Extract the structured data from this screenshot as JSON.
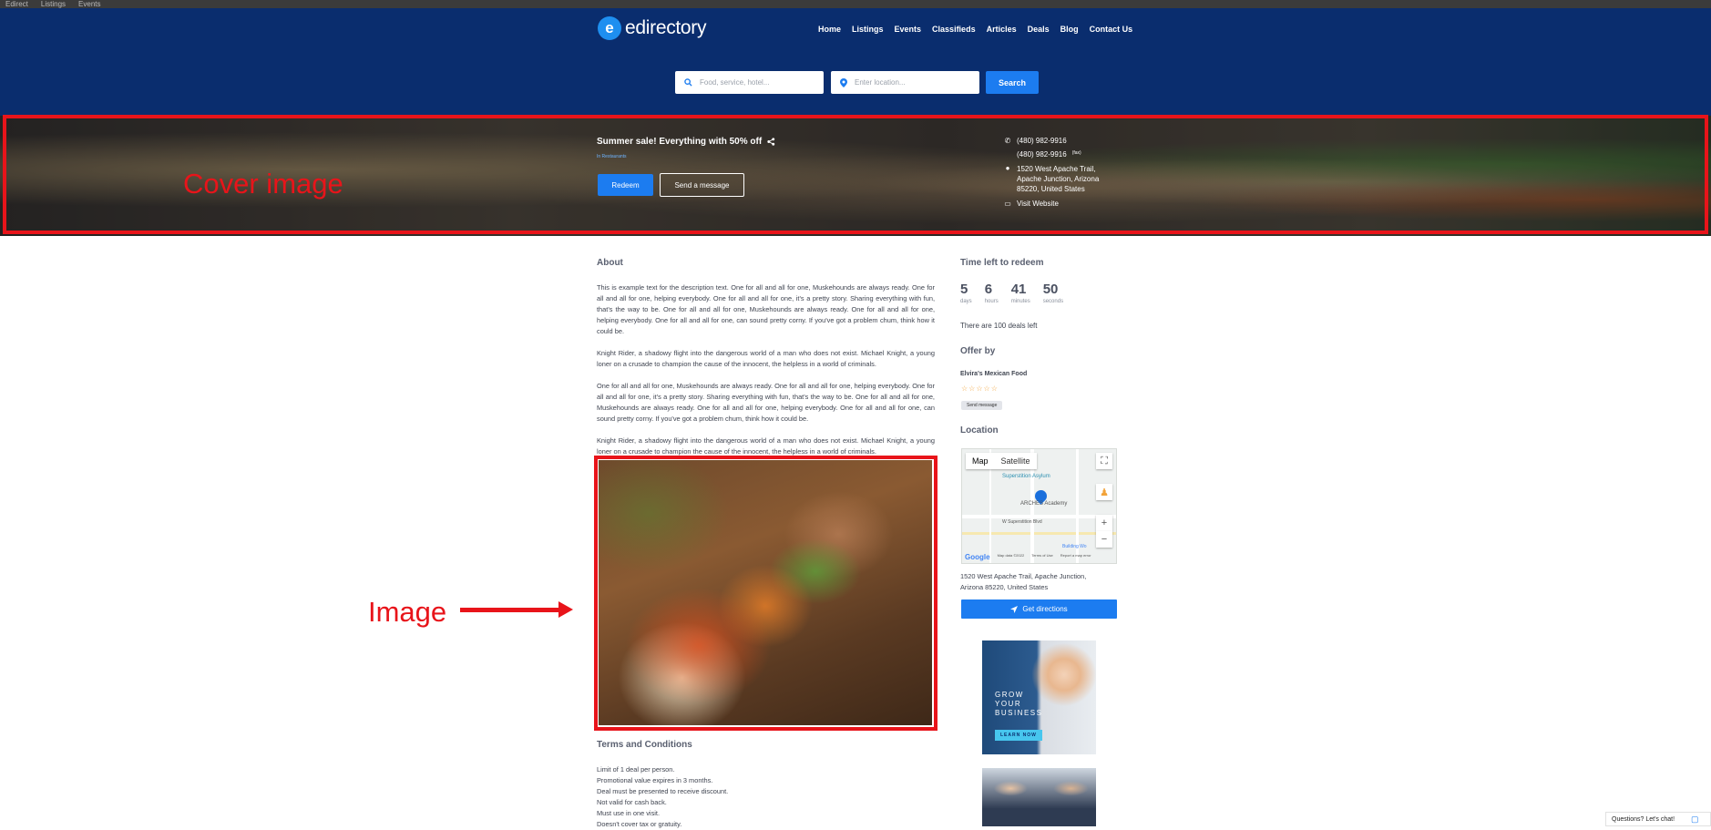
{
  "browser": {
    "tabs": [
      "Edirect",
      "Listings",
      "Events"
    ]
  },
  "brand": {
    "name": "edirectory",
    "badge": "e"
  },
  "nav": {
    "items": [
      "Home",
      "Listings",
      "Events",
      "Classifieds",
      "Articles",
      "Deals",
      "Blog",
      "Contact Us"
    ]
  },
  "search": {
    "keyword_placeholder": "Food, service, hotel...",
    "location_placeholder": "Enter location...",
    "button": "Search"
  },
  "deal": {
    "title": "Summer sale! Everything with 50% off",
    "category": "In Restaurants",
    "redeem_label": "Redeem",
    "message_label": "Send a message"
  },
  "contact": {
    "phone": "(480) 982-9916",
    "fax": "(480) 982-9916",
    "fax_tag": "(fax)",
    "address_lines": [
      "1520 West Apache Trail,",
      "Apache Junction, Arizona",
      "85220, United States"
    ],
    "website_label": "Visit Website"
  },
  "annotations": {
    "cover": "Cover image",
    "image": "Image"
  },
  "about": {
    "heading": "About",
    "paragraphs": [
      "This is example text for the description text. One for all and all for one, Muskehounds are always ready. One for all and all for one, helping everybody. One for all and all for one, it's a pretty story. Sharing everything with fun, that's the way to be. One for all and all for one, Muskehounds are always ready. One for all and all for one, helping everybody. One for all and all for one, can sound pretty corny. If you've got a problem chum, think how it could be.",
      "Knight Rider, a shadowy flight into the dangerous world of a man who does not exist. Michael Knight, a young loner on a crusade to champion the cause of the innocent, the helpless in a world of criminals.",
      "One for all and all for one, Muskehounds are always ready. One for all and all for one, helping everybody. One for all and all for one, it's a pretty story. Sharing everything with fun, that's the way to be. One for all and all for one, Muskehounds are always ready. One for all and all for one, helping everybody. One for all and all for one, can sound pretty corny. If you've got a problem chum, think how it could be.",
      "Knight Rider, a shadowy flight into the dangerous world of a man who does not exist. Michael Knight, a young loner on a crusade to champion the cause of the innocent, the helpless in a world of criminals."
    ]
  },
  "terms": {
    "heading": "Terms and Conditions",
    "lines": [
      "Limit of 1 deal per person.",
      "Promotional value expires in 3 months.",
      "Deal must be presented to receive discount.",
      "Not valid for cash back.",
      "Must use in one visit.",
      "Doesn't cover tax or gratuity."
    ]
  },
  "countdown": {
    "heading": "Time left to redeem",
    "units": [
      {
        "value": "5",
        "label": "days"
      },
      {
        "value": "6",
        "label": "hours"
      },
      {
        "value": "41",
        "label": "minutes"
      },
      {
        "value": "50",
        "label": "seconds"
      }
    ],
    "deals_left": "There are 100 deals left"
  },
  "offer": {
    "heading": "Offer by",
    "seller": "Elvira's Mexican Food",
    "rating": 0,
    "message_label": "Send message"
  },
  "location": {
    "heading": "Location",
    "map_tabs": [
      "Map",
      "Satellite"
    ],
    "map_labels": [
      "Superstition Asylum",
      "ARCHES Academy",
      "W Superstition Blvd",
      "Building Wo"
    ],
    "map_footer": [
      "Google",
      "Map data ©2022",
      "Terms of Use",
      "Report a map error"
    ],
    "address": "1520 West Apache Trail, Apache Junction, Arizona 85220, United States",
    "directions_label": "Get directions"
  },
  "ad": {
    "lines": [
      "GROW",
      "YOUR",
      "BUSINESS"
    ],
    "button": "LEARN NOW"
  },
  "chat": {
    "label": "Questions? Let's chat!"
  },
  "colors": {
    "header": "#0a2d6e",
    "accent": "#1c7cf0",
    "annotation": "#e8141a",
    "star": "#f2a33a"
  }
}
